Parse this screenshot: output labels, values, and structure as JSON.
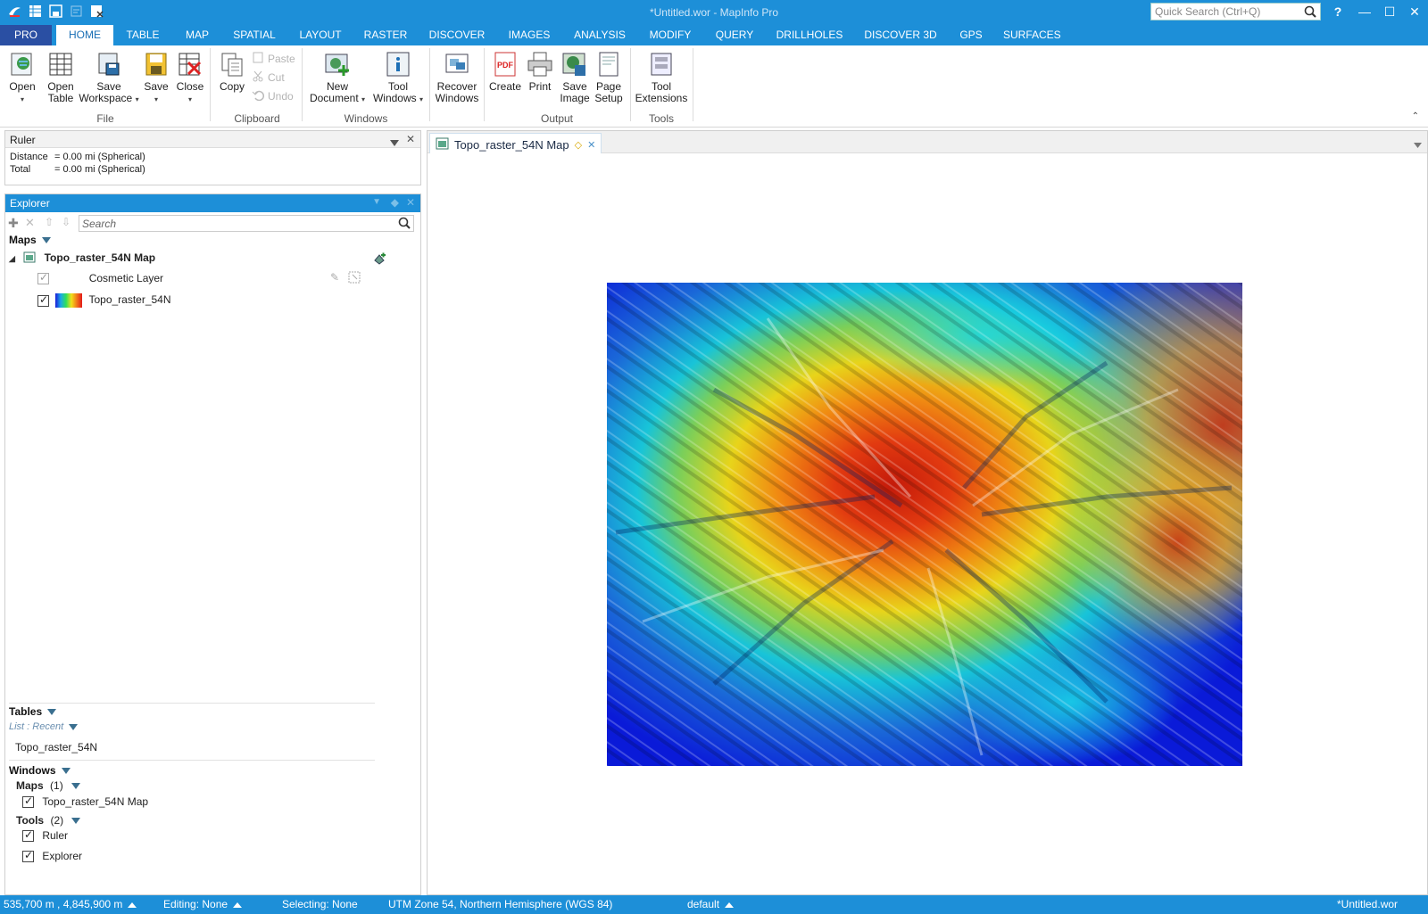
{
  "window": {
    "title": "*Untitled.wor - MapInfo Pro",
    "quick_search_placeholder": "Quick Search (Ctrl+Q)",
    "help": "?",
    "minimize": "—",
    "maximize": "☐",
    "close": "✕"
  },
  "tabs": [
    "PRO",
    "HOME",
    "TABLE",
    "MAP",
    "SPATIAL",
    "LAYOUT",
    "RASTER",
    "DISCOVER",
    "IMAGES",
    "ANALYSIS",
    "MODIFY",
    "QUERY",
    "DRILLHOLES",
    "DISCOVER 3D",
    "GPS",
    "SURFACES"
  ],
  "active_tab": "HOME",
  "ribbon": {
    "file": {
      "label": "File",
      "open": "Open",
      "open_table_1": "Open",
      "open_table_2": "Table",
      "save_workspace_1": "Save",
      "save_workspace_2": "Workspace",
      "save": "Save",
      "close": "Close"
    },
    "clipboard": {
      "label": "Clipboard",
      "copy": "Copy",
      "paste": "Paste",
      "cut": "Cut",
      "undo": "Undo"
    },
    "windows": {
      "label": "Windows",
      "new_document_1": "New",
      "new_document_2": "Document",
      "tool_windows_1": "Tool",
      "tool_windows_2": "Windows",
      "recover_windows_1": "Recover",
      "recover_windows_2": "Windows"
    },
    "output": {
      "label": "Output",
      "create": "Create",
      "print": "Print",
      "save_image_1": "Save",
      "save_image_2": "Image",
      "page_setup_1": "Page",
      "page_setup_2": "Setup"
    },
    "tools": {
      "label": "Tools",
      "tool_extensions_1": "Tool",
      "tool_extensions_2": "Extensions"
    }
  },
  "ruler": {
    "title": "Ruler",
    "distance_label": "Distance",
    "distance_value": "= 0.00 mi (Spherical)",
    "total_label": "Total",
    "total_value": "= 0.00 mi (Spherical)"
  },
  "explorer": {
    "title": "Explorer",
    "search_placeholder": "Search",
    "maps_heading": "Maps",
    "map_name": "Topo_raster_54N Map",
    "layers": [
      {
        "name": "Cosmetic Layer",
        "checked": true
      },
      {
        "name": "Topo_raster_54N",
        "checked": true
      }
    ],
    "tables_heading": "Tables",
    "list_filter": "List : Recent",
    "tables": [
      "Topo_raster_54N"
    ],
    "windows_heading": "Windows",
    "maps_group": "Maps",
    "maps_count": "(1)",
    "map_windows": [
      "Topo_raster_54N Map"
    ],
    "tools_group": "Tools",
    "tools_count": "(2)",
    "tool_windows": [
      "Ruler",
      "Explorer"
    ]
  },
  "document": {
    "tab_title": "Topo_raster_54N Map"
  },
  "status": {
    "coords": "535,700 m , 4,845,900 m",
    "editing": "Editing: None",
    "selecting": "Selecting: None",
    "projection": "UTM Zone 54, Northern Hemisphere (WGS 84)",
    "style": "default",
    "workspace": "*Untitled.wor"
  }
}
